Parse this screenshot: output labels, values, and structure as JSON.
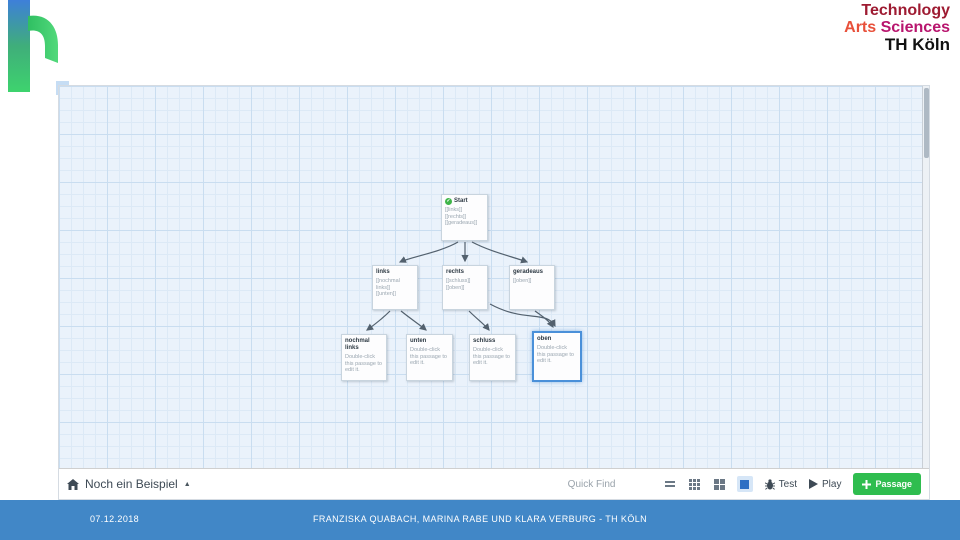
{
  "brand": {
    "line1": "Technology",
    "line2_part1": "Arts",
    "line2_part2": "Sciences",
    "line3": "TH Köln",
    "colors": {
      "technology": "#9E1B32",
      "arts": "#E8503A",
      "sciences": "#B8156E",
      "th_koeln": "#111111"
    }
  },
  "footer": {
    "date": "07.12.2018",
    "credits": "FRANZISKA QUABACH, MARINA RABE UND KLARA VERBURG - TH KÖLN",
    "background": "#4187C7"
  },
  "twine": {
    "story_title": "Noch ein Beispiel",
    "quick_find_placeholder": "Quick Find",
    "toolbar": {
      "test_label": "Test",
      "play_label": "Play",
      "new_passage_label": "Passage",
      "new_passage_color": "#2FBD4F"
    },
    "start_badge": "✓",
    "nodes": [
      {
        "title": "Start",
        "body": "[[links]]\n[[rechts]]\n[[geradeaus]]",
        "is_start": true,
        "selected": false
      },
      {
        "title": "links",
        "body": "[[nochmal links]]\n[[unten]]",
        "is_start": false,
        "selected": false
      },
      {
        "title": "rechts",
        "body": "[[schluss]]\n[[oben]]",
        "is_start": false,
        "selected": false
      },
      {
        "title": "geradeaus",
        "body": "[[oben]]",
        "is_start": false,
        "selected": false
      },
      {
        "title": "nochmal links",
        "body": "Double-click this passage to edit it.",
        "is_start": false,
        "selected": false
      },
      {
        "title": "unten",
        "body": "Double-click this passage to edit it.",
        "is_start": false,
        "selected": false
      },
      {
        "title": "schluss",
        "body": "Double-click this passage to edit it.",
        "is_start": false,
        "selected": false
      },
      {
        "title": "oben",
        "body": "Double-click this passage to edit it.",
        "is_start": false,
        "selected": true
      }
    ]
  }
}
